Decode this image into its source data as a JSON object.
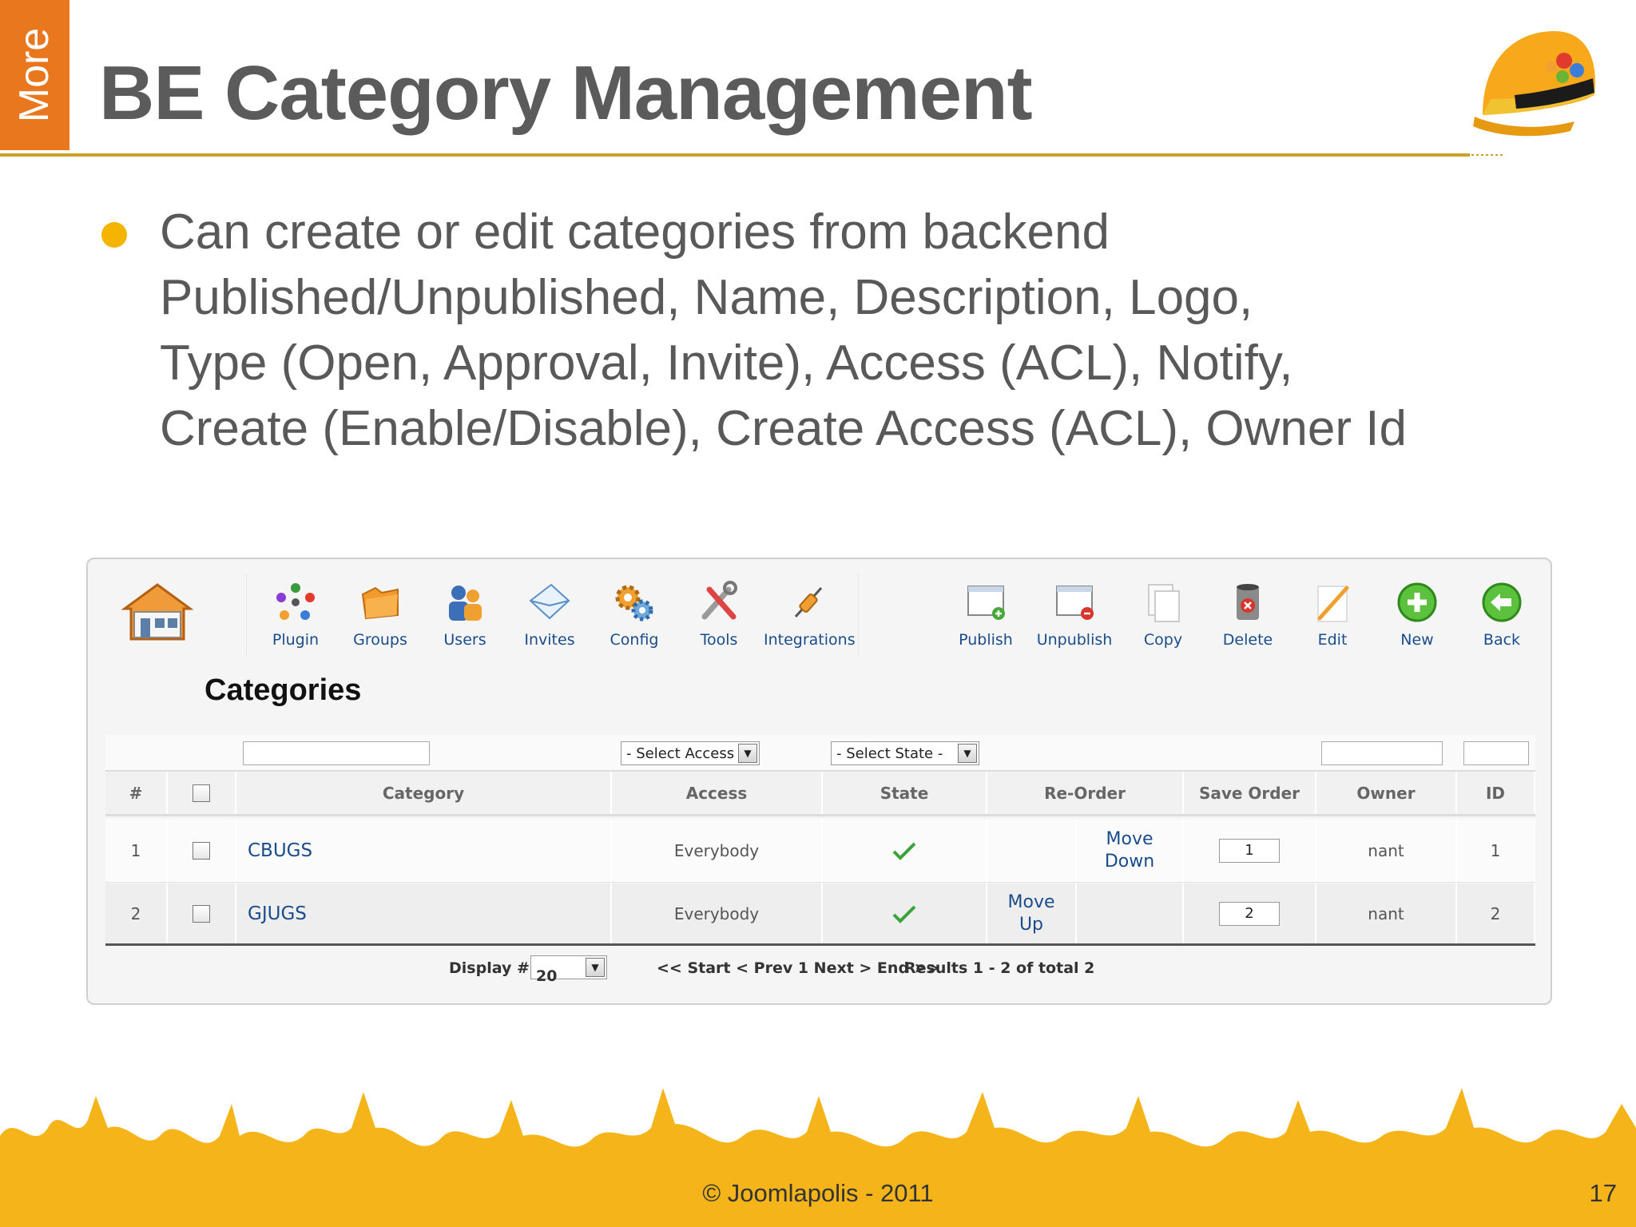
{
  "slide": {
    "side_tab": "More",
    "title": "BE Category Management",
    "bullet_lines": [
      "Can create or edit categories from backend",
      "Published/Unpublished, Name, Description, Logo,",
      "Type (Open, Approval, Invite), Access (ACL), Notify,",
      "Create (Enable/Disable), Create Access (ACL), Owner Id"
    ],
    "copyright": "© Joomlapolis - 2011",
    "page_number": "17",
    "colors": {
      "accent_orange": "#e8771e",
      "rule_gold": "#c9a227",
      "bullet_yellow": "#f4b400",
      "crowd_yellow": "#f4b41a"
    }
  },
  "toolbar": {
    "plugin": "Plugin",
    "groups": "Groups",
    "users": "Users",
    "invites": "Invites",
    "config": "Config",
    "tools": "Tools",
    "integrations": "Integrations",
    "publish": "Publish",
    "unpublish": "Unpublish",
    "copy": "Copy",
    "delete": "Delete",
    "edit": "Edit",
    "new": "New",
    "back": "Back"
  },
  "page_heading": "Categories",
  "filters": {
    "access_select": "- Select Access -",
    "state_select": "- Select State -"
  },
  "columns": {
    "num": "#",
    "category": "Category",
    "access": "Access",
    "state": "State",
    "reorder": "Re-Order",
    "save_order": "Save Order",
    "owner": "Owner",
    "id": "ID"
  },
  "rows": [
    {
      "num": "1",
      "category": "CBUGS",
      "access": "Everybody",
      "state_icon": "check-icon",
      "move_line1": "Move",
      "move_line2": "Down",
      "order": "1",
      "owner": "nant",
      "id": "1"
    },
    {
      "num": "2",
      "category": "GJUGS",
      "access": "Everybody",
      "state_icon": "check-icon",
      "move_line1": "Move",
      "move_line2": "Up",
      "order": "2",
      "owner": "nant",
      "id": "2"
    }
  ],
  "pagination": {
    "display_label": "Display #",
    "display_value": "20",
    "nav": "<< Start < Prev 1 Next > End >>",
    "results": "Results 1 - 2 of total 2"
  }
}
